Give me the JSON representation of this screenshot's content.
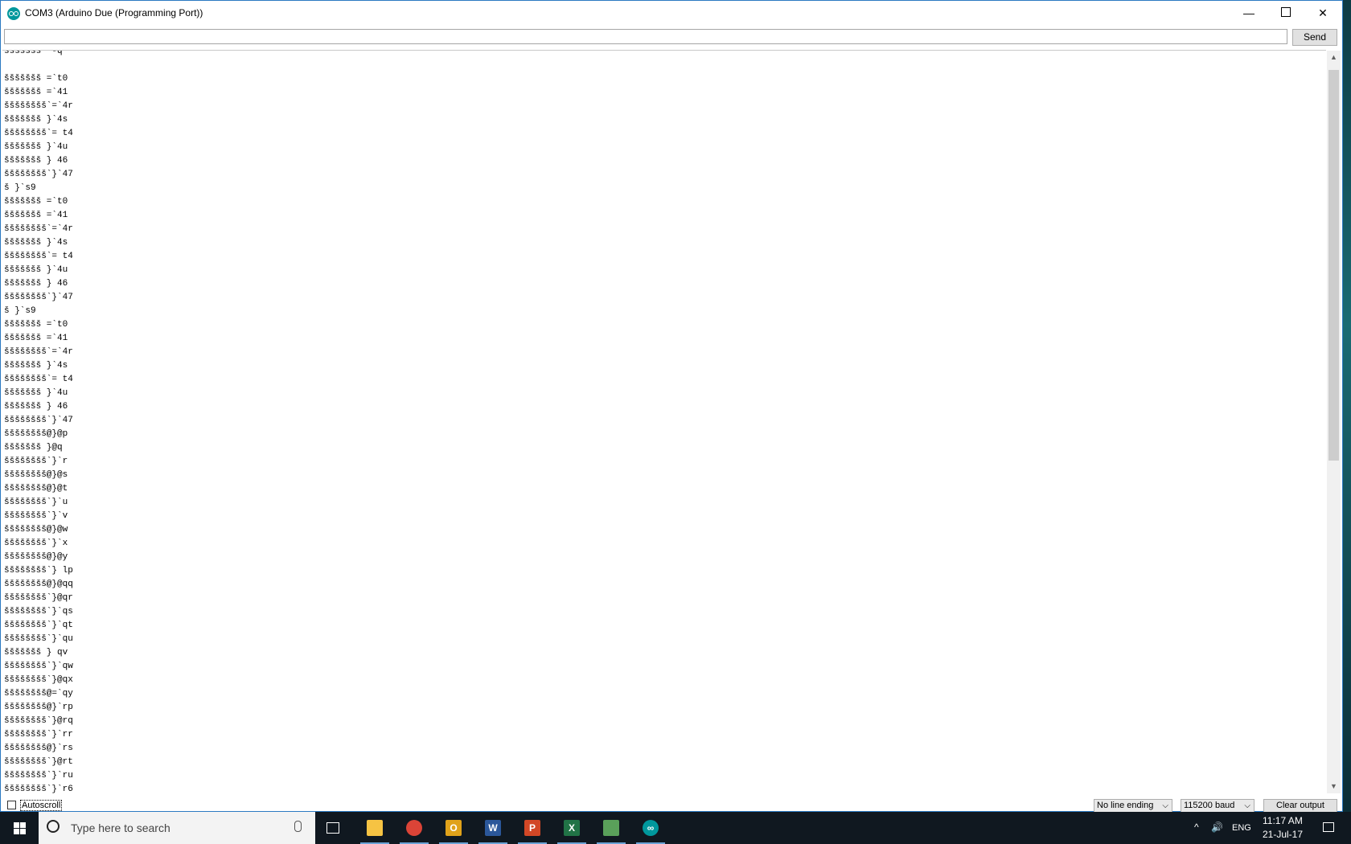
{
  "window": {
    "title": "COM3 (Arduino Due (Programming Port))",
    "min_glyph": "—",
    "close_glyph": "✕"
  },
  "toolbar": {
    "send_label": "Send",
    "input_value": ""
  },
  "output": {
    "lines": [
      "ššššššš  -q",
      "",
      "ššššššš =`t0",
      "ššššššš =`41",
      "šššššššš`=`4r",
      "ššššššš }`4s",
      "šššššššš`= t4",
      "ššššššš }`4u",
      "ššššššš } 46",
      "šššššššš`}`47",
      "š }`s9",
      "ššššššš =`t0",
      "ššššššš =`41",
      "šššššššš`=`4r",
      "ššššššš }`4s",
      "šššššššš`= t4",
      "ššššššš }`4u",
      "ššššššš } 46",
      "šššššššš`}`47",
      "š }`s9",
      "ššššššš =`t0",
      "ššššššš =`41",
      "šššššššš`=`4r",
      "ššššššš }`4s",
      "šššššššš`= t4",
      "ššššššš }`4u",
      "ššššššš } 46",
      "šššššššš`}`47",
      "šššššššš@}@p",
      "ššššššš }@q",
      "šššššššš`}`r",
      "šššššššš@}@s",
      "šššššššš@}@t",
      "šššššššš`}`u",
      "šššššššš`}`v",
      "šššššššš@}@w",
      "šššššššš`}`x",
      "šššššššš@}@y",
      "šššššššš`} lp",
      "šššššššš@}@qq",
      "šššššššš`}@qr",
      "šššššššš`}`qs",
      "šššššššš`}`qt",
      "šššššššš`}`qu",
      "ššššššš } qv",
      "šššššššš`}`qw",
      "šššššššš`}@qx",
      "šššššššš@=`qy",
      "šššššššš@}`rp",
      "šššššššš`}@rq",
      "šššššššš`}`rr",
      "šššššššš@}`rs",
      "šššššššš`}@rt",
      "šššššššš`}`ru",
      "šššššššš`}`r6"
    ]
  },
  "scrollbar": {
    "up_glyph": "▲",
    "down_glyph": "▼"
  },
  "bottom": {
    "autoscroll_label": "Autoscroll",
    "line_ending": "No line ending",
    "baud": "115200 baud",
    "clear_label": "Clear output",
    "chevron": "⌵"
  },
  "taskbar": {
    "search_placeholder": "Type here to search",
    "apps": [
      {
        "name": "file-explorer-icon",
        "glyph": "",
        "color": "#f6c343"
      },
      {
        "name": "chrome-icon",
        "glyph": "",
        "color": "#db4437"
      },
      {
        "name": "outlook-icon",
        "glyph": "O",
        "color": "#e0a21a"
      },
      {
        "name": "word-icon",
        "glyph": "W",
        "color": "#2b579a"
      },
      {
        "name": "powerpoint-icon",
        "glyph": "P",
        "color": "#d24726"
      },
      {
        "name": "excel-icon",
        "glyph": "X",
        "color": "#217346"
      },
      {
        "name": "files-icon",
        "glyph": "",
        "color": "#5aa05a"
      },
      {
        "name": "arduino-icon",
        "glyph": "∞",
        "color": "#00979c"
      }
    ],
    "tray": {
      "chevron": "^",
      "volume": "🔊",
      "language": "ENG",
      "time": "11:17 AM",
      "date": "21-Jul-17"
    }
  }
}
